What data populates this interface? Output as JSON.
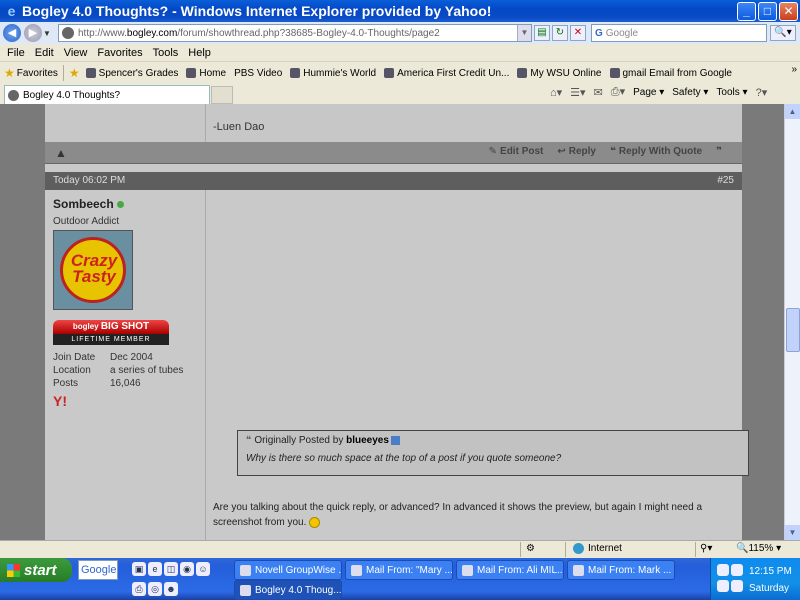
{
  "window": {
    "title": "Bogley 4.0 Thoughts? - Windows Internet Explorer provided by Yahoo!",
    "minimize": "_",
    "maximize": "□",
    "close": "✕"
  },
  "address": {
    "url_prefix": "http://www.",
    "url_host": "bogley.com",
    "url_path": "/forum/showthread.php?38685-Bogley-4.0-Thoughts/page2",
    "search_placeholder": "Google",
    "search_go": "🔍▾"
  },
  "menu": [
    "File",
    "Edit",
    "View",
    "Favorites",
    "Tools",
    "Help"
  ],
  "favorites": {
    "label": "Favorites",
    "items": [
      "Spencer's Grades",
      "Home",
      "PBS Video",
      "Hummie's World",
      "America First Credit Un...",
      "My WSU Online",
      "gmail Email from Google"
    ]
  },
  "tab": {
    "title": "Bogley 4.0 Thoughts?"
  },
  "commandbar": [
    "Page ▾",
    "Safety ▾",
    "Tools ▾"
  ],
  "prev_post": {
    "signature": "-Luen Dao",
    "actions": [
      "Edit Post",
      "Reply",
      "Reply With Quote"
    ]
  },
  "post": {
    "date": "Today 06:02 PM",
    "number": "#25",
    "username": "Sombeech",
    "user_title": "Outdoor Addict",
    "avatar_text": "Crazy Tasty",
    "badge_brand": "bogley",
    "badge_title": "BIG SHOT",
    "badge_sub": "LIFETIME MEMBER",
    "stats": [
      {
        "key": "Join Date",
        "value": "Dec 2004"
      },
      {
        "key": "Location",
        "value": "a series of tubes"
      },
      {
        "key": "Posts",
        "value": "16,046"
      }
    ],
    "quote_prefix": "Originally Posted by",
    "quote_author": "blueeyes",
    "quote_text": "Why is there so much space at the top of a post if you quote someone?",
    "reply_text": "Are you talking about the quick reply, or advanced? In advanced it shows the preview, but again I might need a screenshot from you."
  },
  "status": {
    "zone": "Internet",
    "zoom": "115%"
  },
  "taskbar": {
    "start": "start",
    "google": "Google",
    "buttons": [
      "Novell GroupWise ...",
      "Mail From: \"Mary ...",
      "Mail From: Ali MIL...",
      "Mail From: Mark ...",
      "Bogley 4.0 Thoug..."
    ],
    "time": "12:15 PM",
    "day": "Saturday"
  },
  "colors": {
    "titlebar": "#0348c7",
    "taskbar": "#245edb",
    "start": "#2f8a2f"
  }
}
